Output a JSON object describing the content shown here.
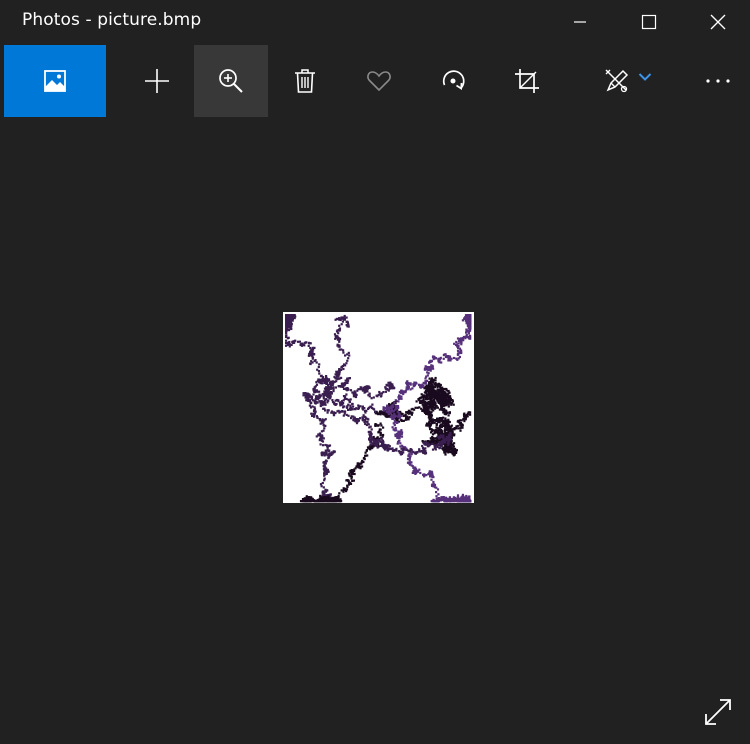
{
  "window": {
    "title": "Photos - picture.bmp"
  },
  "toolbar": {
    "buttons": [
      {
        "id": "gallery",
        "icon": "picture-icon",
        "active": true
      },
      {
        "id": "add",
        "icon": "plus-icon"
      },
      {
        "id": "zoom",
        "icon": "zoom-in-icon",
        "hovered": true
      },
      {
        "id": "delete",
        "icon": "trash-icon"
      },
      {
        "id": "favorite",
        "icon": "heart-icon"
      },
      {
        "id": "rotate",
        "icon": "rotate-icon"
      },
      {
        "id": "crop",
        "icon": "crop-icon"
      },
      {
        "id": "edit",
        "icon": "edit-draw-icon"
      },
      {
        "id": "more",
        "icon": "more-icon"
      }
    ]
  },
  "colors": {
    "background": "#212121",
    "accent": "#0078d7",
    "hover": "#383838",
    "fractal_dark": "#1a0a1f",
    "fractal_mid": "#3a1e50",
    "fractal_light": "#56317a"
  }
}
